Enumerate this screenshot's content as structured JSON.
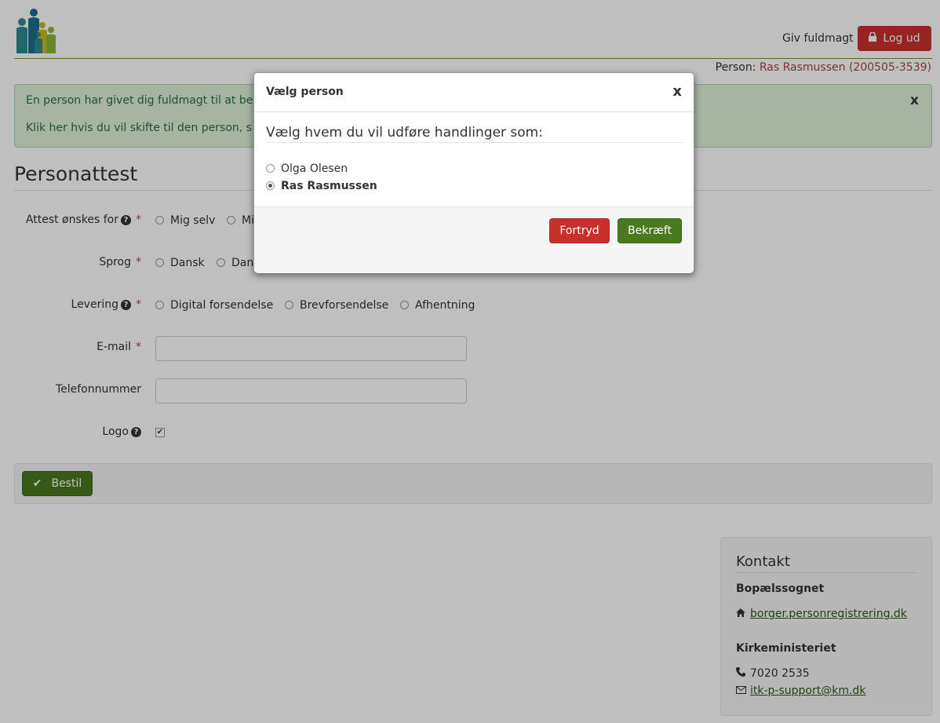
{
  "header": {
    "giv_fuldmagt": "Giv fuldmagt",
    "logout_label": "Log ud",
    "person_prefix": "Person:",
    "person_name": "Ras Rasmussen (200505-3539)"
  },
  "alert": {
    "line1": "En person har givet dig fuldmagt til at be",
    "line2": "Klik her hvis du vil skifte til den person, s",
    "close": "x"
  },
  "page": {
    "title": "Personattest"
  },
  "form": {
    "attest": {
      "label": "Attest ønskes for",
      "options": [
        "Mig selv",
        "Mi"
      ]
    },
    "sprog": {
      "label": "Sprog",
      "options": [
        "Dansk",
        "Dan"
      ]
    },
    "levering": {
      "label": "Levering",
      "options": [
        "Digital forsendelse",
        "Brevforsendelse",
        "Afhentning"
      ]
    },
    "email": {
      "label": "E-mail",
      "value": ""
    },
    "telefon": {
      "label": "Telefonnummer",
      "value": ""
    },
    "logo": {
      "label": "Logo",
      "checked": true
    },
    "required_mark": "*",
    "help_mark": "?",
    "submit_label": "Bestil"
  },
  "contact": {
    "title": "Kontakt",
    "section1": "Bopælssognet",
    "link1": "borger.personregistrering.dk",
    "section2": "Kirkeministeriet",
    "phone": "7020 2535",
    "email": "itk-p-support@km.dk"
  },
  "modal": {
    "title": "Vælg person",
    "close": "x",
    "prompt": "Vælg hvem du vil udføre handlinger som:",
    "choices": [
      {
        "name": "Olga Olesen",
        "selected": false
      },
      {
        "name": "Ras Rasmussen",
        "selected": true
      }
    ],
    "cancel_label": "Fortryd",
    "confirm_label": "Bekræft"
  },
  "colors": {
    "danger": "#c9302c",
    "success": "#4a7a1f",
    "alert_bg": "#dff0d8",
    "link": "#2d5a1a"
  }
}
